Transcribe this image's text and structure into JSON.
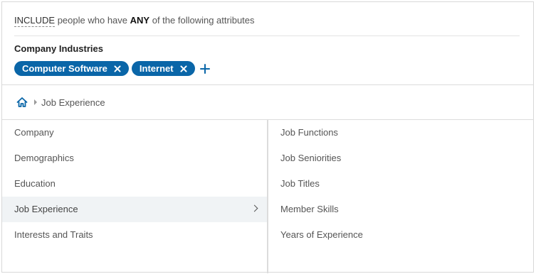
{
  "rule": {
    "include_label": "INCLUDE",
    "text_before": "people who have",
    "quantifier": "ANY",
    "text_after": "of the following attributes"
  },
  "group": {
    "title": "Company Industries",
    "pills": [
      {
        "label": "Computer Software"
      },
      {
        "label": "Internet"
      }
    ],
    "add_icon": "plus-icon",
    "remove_icon": "close-icon"
  },
  "breadcrumb": {
    "home_icon": "home-icon",
    "current": "Job Experience"
  },
  "categories": [
    {
      "label": "Company"
    },
    {
      "label": "Demographics"
    },
    {
      "label": "Education"
    },
    {
      "label": "Job Experience"
    },
    {
      "label": "Interests and Traits"
    }
  ],
  "subcategories": [
    {
      "label": "Job Functions"
    },
    {
      "label": "Job Seniorities"
    },
    {
      "label": "Job Titles"
    },
    {
      "label": "Member Skills"
    },
    {
      "label": "Years of Experience"
    }
  ],
  "colors": {
    "accent": "#0a66a8",
    "selected_bg": "#f0f3f5",
    "border": "#dcdcdc"
  }
}
